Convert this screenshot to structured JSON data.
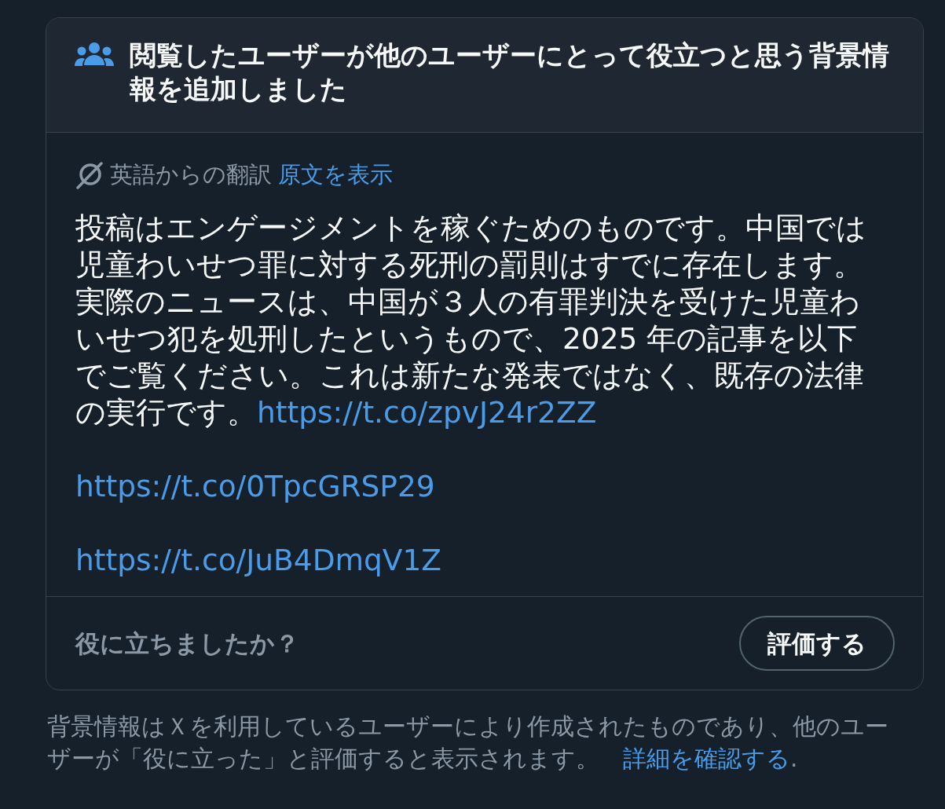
{
  "note_card": {
    "header": "閲覧したユーザーが他のユーザーにとって役立つと思う背景情報を追加しました",
    "translation": {
      "label": "英語からの翻訳",
      "show_original": "原文を表示"
    },
    "body": {
      "text": "投稿はエンゲージメントを稼ぐためのものです。中国では児童わいせつ罪に対する死刑の罰則はすでに存在します。実際のニュースは、中国が３人の有罪判決を受けた児童わいせつ犯を処刑したというもので、2025 年の記事を以下でご覧ください。これは新たな発表ではなく、既存の法律の実行です。",
      "link": "https://t.co/zpvJ24r2ZZ"
    },
    "extra_links": [
      "https://t.co/0TpcGRSP29",
      "https://t.co/JuB4DmqV1Z"
    ],
    "footer": {
      "question": "役に立ちましたか？",
      "rate_button": "評価する"
    }
  },
  "disclaimer": {
    "text": "背景情報はＸを利用しているユーザーにより作成されたものであり、他のユーザーが「役に立った」と評価すると表示されます。",
    "link": "詳細を確認する",
    "tail": "."
  }
}
